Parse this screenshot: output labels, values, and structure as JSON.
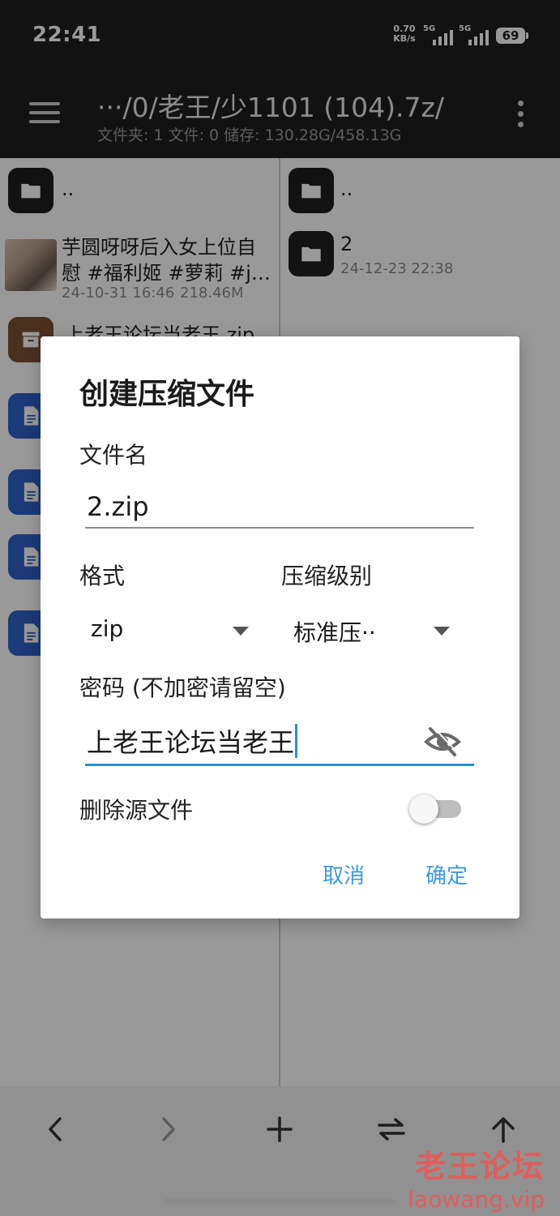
{
  "status": {
    "time": "22:41",
    "net_speed_value": "0.70",
    "net_speed_unit": "KB/s",
    "sim1": "5G",
    "sim2": "5G",
    "battery": "69"
  },
  "toolbar": {
    "path": "···/0/老王/少1101 (104).7z/",
    "info": "文件夹: 1  文件: 0  储存: 130.28G/458.13G"
  },
  "left_pane": {
    "items": [
      {
        "name": "..",
        "type": "folder"
      },
      {
        "name_line1": "芋圆呀呀后入女上位自",
        "name_line2": "慰 #福利姬 #萝莉 #j…",
        "date": "24-10-31 16:46",
        "size": "218.46M",
        "type": "video"
      },
      {
        "name": "上老王论坛当老王.zip",
        "type": "archive"
      },
      {
        "type": "doc"
      },
      {
        "type": "doc"
      },
      {
        "type": "doc"
      },
      {
        "type": "doc"
      }
    ]
  },
  "right_pane": {
    "items": [
      {
        "name": "..",
        "type": "folder"
      },
      {
        "name": "2",
        "date": "24-12-23 22:38",
        "type": "folder"
      }
    ]
  },
  "dialog": {
    "title": "创建压缩文件",
    "filename_label": "文件名",
    "filename_value": "2.zip",
    "format_label": "格式",
    "format_value": "zip",
    "level_label": "压缩级别",
    "level_value": "标准压··",
    "password_label": "密码 (不加密请留空)",
    "password_value": "上老王论坛当老王",
    "delete_source_label": "删除源文件",
    "delete_source_on": false,
    "cancel_label": "取消",
    "ok_label": "确定",
    "accent_color": "#3a9be0"
  },
  "bottombar": {
    "buttons": [
      "back-icon",
      "forward-icon",
      "add-icon",
      "swap-icon",
      "up-icon"
    ]
  },
  "watermark": {
    "line1": "老王论坛",
    "line2": "laowang.vip"
  }
}
